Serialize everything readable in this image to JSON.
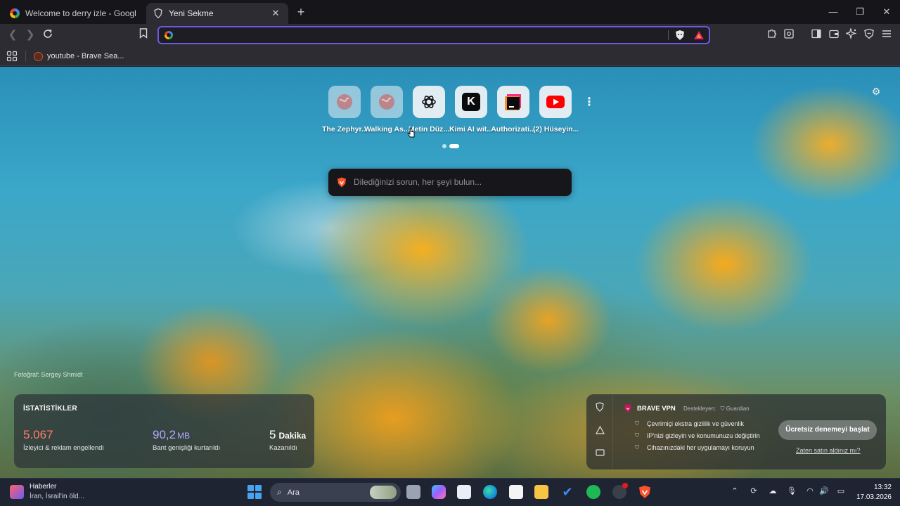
{
  "tabs": [
    {
      "title": "Welcome to derry izle - Google'da Ara",
      "active": false,
      "icon": "google-icon"
    },
    {
      "title": "Yeni Sekme",
      "active": true,
      "icon": "brave-shield-icon"
    }
  ],
  "omnibox": {
    "value": "",
    "placeholder": ""
  },
  "bookmarks": [
    {
      "label": "youtube - Brave Sea...",
      "icon": "brave-search-icon"
    }
  ],
  "top_sites": [
    {
      "label": "The Zephyr...",
      "icon": "globe-icon"
    },
    {
      "label": "Walking As...",
      "icon": "globe-icon"
    },
    {
      "label": "Metin Düz...",
      "icon": "chatgpt-icon"
    },
    {
      "label": "Kimi AI wit...",
      "icon": "kimi-icon"
    },
    {
      "label": "Authorizati...",
      "icon": "jetbrains-icon"
    },
    {
      "label": "(2) Hüseyin...",
      "icon": "youtube-icon"
    }
  ],
  "search": {
    "placeholder": "Dilediğinizi sorun, her şeyi bulun..."
  },
  "photo_credit": "Fotoğraf: Sergey Shmidt",
  "stats": {
    "heading": "İSTATİSTİKLER",
    "items": [
      {
        "value": "5.067",
        "unit": "",
        "caption": "İzleyici & reklam engellendi",
        "color": "#ff7a6b"
      },
      {
        "value": "90,2",
        "unit": "MB",
        "caption": "Bant genişliği kurtarıldı",
        "color": "#b7a6ff"
      },
      {
        "value": "5",
        "unit": "Dakika",
        "caption": "Kazanıldı",
        "color": "#ffffff"
      }
    ]
  },
  "vpn": {
    "title": "BRAVE VPN",
    "sponsor": "Destekleyen:",
    "sponsor_name": "Guardian",
    "features": [
      "Çevrimiçi ekstra gizlilik ve güvenlik",
      "IP'nizi gizleyin ve konumunuzu değiştirin",
      "Cihazınızdaki her uygulamayı koruyun"
    ],
    "cta": "Ücretsiz denemeyi başlat",
    "secondary": "Zaten satın aldınız mı?"
  },
  "taskbar": {
    "news_title": "Haberler",
    "news_sub": "İran, İsrail'in öld...",
    "search_label": "Ara",
    "time": "13:32",
    "date": "17.03.2026"
  },
  "colors": {
    "accent": "#6e58e8",
    "brave_orange": "#fb542b"
  }
}
